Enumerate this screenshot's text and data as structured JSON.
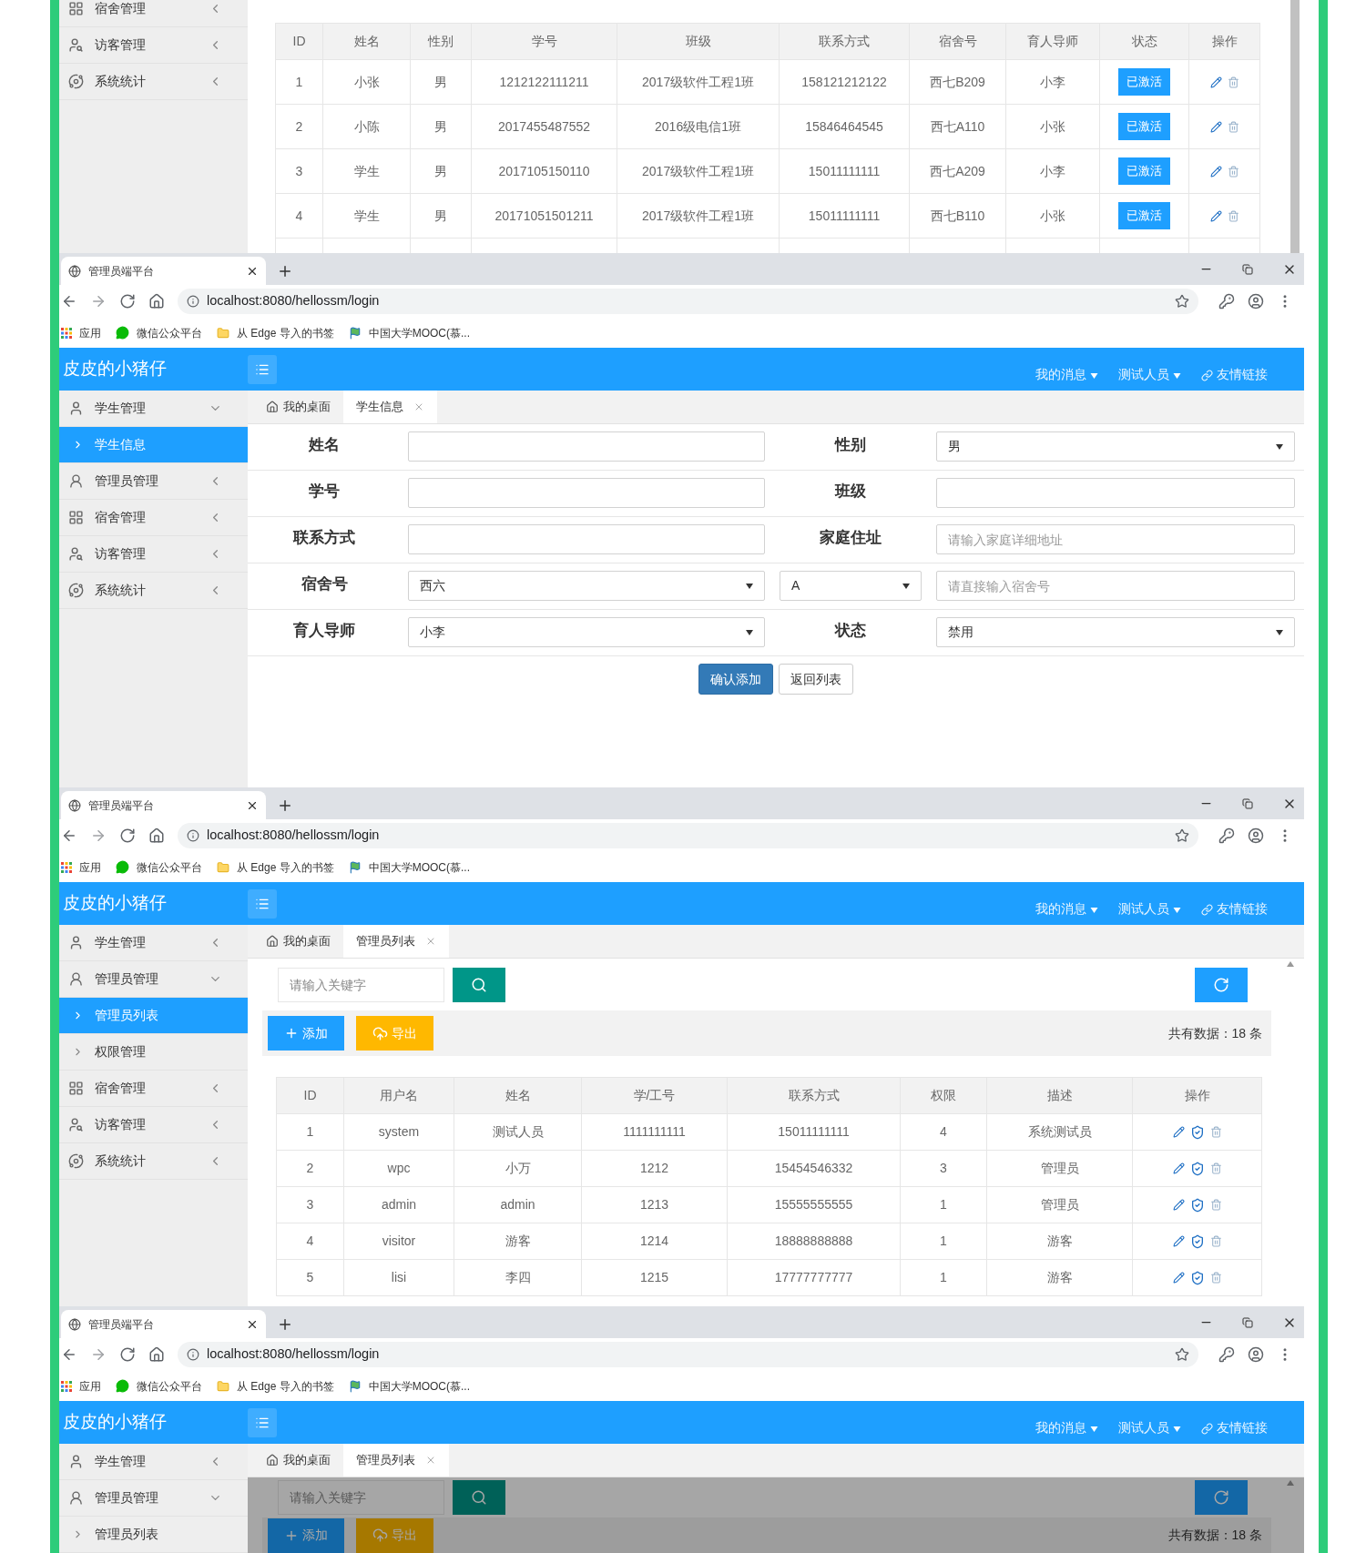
{
  "panels": [
    {
      "kind": "list_fragment",
      "sidebar": [
        {
          "label": "宿舍管理",
          "kind": "dorm",
          "expanded": false,
          "selected": false
        },
        {
          "label": "访客管理",
          "kind": "visitor",
          "expanded": false,
          "selected": false
        },
        {
          "label": "系统统计",
          "kind": "stats",
          "expanded": false,
          "selected": false
        }
      ],
      "table": {
        "columns": [
          "ID",
          "姓名",
          "性别",
          "学号",
          "班级",
          "联系方式",
          "宿舍号",
          "育人导师",
          "状态",
          "操作"
        ],
        "rows": [
          {
            "cells": [
              "1",
              "小张",
              "男",
              "1212122111211",
              "2017级软件工程1班",
              "158121212122",
              "西七B209",
              "小李"
            ],
            "status": "已激活"
          },
          {
            "cells": [
              "2",
              "小陈",
              "男",
              "2017455487552",
              "2016级电信1班",
              "15846464545",
              "西七A110",
              "小张"
            ],
            "status": "已激活"
          },
          {
            "cells": [
              "3",
              "学生",
              "男",
              "2017105150110",
              "2017级软件工程1班",
              "15011111111",
              "西七A209",
              "小李"
            ],
            "status": "已激活"
          },
          {
            "cells": [
              "4",
              "学生",
              "男",
              "20171051501211",
              "2017级软件工程1班",
              "15011111111",
              "西七B110",
              "小张"
            ],
            "status": "已激活"
          }
        ]
      }
    },
    {
      "kind": "browser",
      "tab_title": "管理员端平台",
      "url": "localhost:8080/hellossm/login",
      "bookmarks": [
        {
          "kind": "apps",
          "label": "应用"
        },
        {
          "kind": "wechat",
          "label": "微信公众平台"
        },
        {
          "kind": "folder",
          "label": "从 Edge 导入的书签"
        },
        {
          "kind": "mooc",
          "label": "中国大学MOOC(慕..."
        }
      ],
      "brand": "皮皮的小猪仔",
      "header_menu": [
        {
          "kind": "dropdown",
          "label": "我的消息"
        },
        {
          "kind": "dropdown",
          "label": "测试人员"
        },
        {
          "kind": "link",
          "label": "友情链接"
        }
      ],
      "sidebar": [
        {
          "label": "学生管理",
          "kind": "student",
          "expanded": true,
          "selected": false,
          "children": [
            {
              "label": "学生信息",
              "selected": true
            }
          ]
        },
        {
          "label": "管理员管理",
          "kind": "admin",
          "expanded": false,
          "selected": false
        },
        {
          "label": "宿舍管理",
          "kind": "dorm",
          "expanded": false,
          "selected": false
        },
        {
          "label": "访客管理",
          "kind": "visitor",
          "expanded": false,
          "selected": false
        },
        {
          "label": "系统统计",
          "kind": "stats",
          "expanded": false,
          "selected": false
        }
      ],
      "page_tabs": [
        {
          "kind": "home",
          "label": "我的桌面",
          "selected": false
        },
        {
          "kind": "page",
          "label": "学生信息",
          "selected": true
        }
      ],
      "content": {
        "kind": "form",
        "rows": [
          [
            {
              "kind": "label",
              "text": "姓名"
            },
            {
              "kind": "input"
            },
            {
              "kind": "label",
              "text": "性别"
            },
            {
              "kind": "select",
              "value": "男"
            }
          ],
          [
            {
              "kind": "label",
              "text": "学号"
            },
            {
              "kind": "input"
            },
            {
              "kind": "label",
              "text": "班级"
            },
            {
              "kind": "input"
            }
          ],
          [
            {
              "kind": "label",
              "text": "联系方式"
            },
            {
              "kind": "input"
            },
            {
              "kind": "label",
              "text": "家庭住址"
            },
            {
              "kind": "input",
              "placeholder": "请输入家庭详细地址"
            }
          ],
          [
            {
              "kind": "label",
              "text": "宿舍号"
            },
            {
              "kind": "select",
              "value": "西六"
            },
            {
              "kind": "select",
              "value": "A"
            },
            {
              "kind": "input",
              "placeholder": "请直接输入宿舍号"
            }
          ],
          [
            {
              "kind": "label",
              "text": "育人导师"
            },
            {
              "kind": "select",
              "value": "小李"
            },
            {
              "kind": "label",
              "text": "状态"
            },
            {
              "kind": "select",
              "value": "禁用"
            }
          ]
        ],
        "buttons": [
          {
            "kind": "primary",
            "label": "确认添加"
          },
          {
            "kind": "default",
            "label": "返回列表"
          }
        ]
      }
    },
    {
      "kind": "browser",
      "tab_title": "管理员端平台",
      "url": "localhost:8080/hellossm/login",
      "bookmarks": [
        {
          "kind": "apps",
          "label": "应用"
        },
        {
          "kind": "wechat",
          "label": "微信公众平台"
        },
        {
          "kind": "folder",
          "label": "从 Edge 导入的书签"
        },
        {
          "kind": "mooc",
          "label": "中国大学MOOC(慕..."
        }
      ],
      "brand": "皮皮的小猪仔",
      "header_menu": [
        {
          "kind": "dropdown",
          "label": "我的消息"
        },
        {
          "kind": "dropdown",
          "label": "测试人员"
        },
        {
          "kind": "link",
          "label": "友情链接"
        }
      ],
      "sidebar": [
        {
          "label": "学生管理",
          "kind": "student",
          "expanded": false,
          "selected": false
        },
        {
          "label": "管理员管理",
          "kind": "admin",
          "expanded": true,
          "selected": false,
          "children": [
            {
              "label": "管理员列表",
              "selected": true
            },
            {
              "label": "权限管理",
              "selected": false
            }
          ]
        },
        {
          "label": "宿舍管理",
          "kind": "dorm",
          "expanded": false,
          "selected": false
        },
        {
          "label": "访客管理",
          "kind": "visitor",
          "expanded": false,
          "selected": false
        },
        {
          "label": "系统统计",
          "kind": "stats",
          "expanded": false,
          "selected": false
        }
      ],
      "page_tabs": [
        {
          "kind": "home",
          "label": "我的桌面",
          "selected": false
        },
        {
          "kind": "page",
          "label": "管理员列表",
          "selected": true
        }
      ],
      "content": {
        "kind": "list",
        "dimmed": false,
        "search": {
          "placeholder": "请输入关键字"
        },
        "buttons": [
          {
            "kind": "add",
            "label": "添加"
          },
          {
            "kind": "export",
            "label": "导出"
          }
        ],
        "total": "共有数据：18 条",
        "table": {
          "columns": [
            "ID",
            "用户名",
            "姓名",
            "学/工号",
            "联系方式",
            "权限",
            "描述",
            "操作"
          ],
          "rows": [
            {
              "cells": [
                "1",
                "system",
                "测试人员",
                "1111111111",
                "15011111111",
                "4",
                "系统测试员"
              ]
            },
            {
              "cells": [
                "2",
                "wpc",
                "小万",
                "1212",
                "15454546332",
                "3",
                "管理员"
              ]
            },
            {
              "cells": [
                "3",
                "admin",
                "admin",
                "1213",
                "15555555555",
                "1",
                "管理员"
              ]
            },
            {
              "cells": [
                "4",
                "visitor",
                "游客",
                "1214",
                "18888888888",
                "1",
                "游客"
              ]
            },
            {
              "cells": [
                "5",
                "lisi",
                "李四",
                "1215",
                "17777777777",
                "1",
                "游客"
              ]
            }
          ]
        }
      }
    },
    {
      "kind": "browser",
      "tab_title": "管理员端平台",
      "url": "localhost:8080/hellossm/login",
      "bookmarks": [
        {
          "kind": "apps",
          "label": "应用"
        },
        {
          "kind": "wechat",
          "label": "微信公众平台"
        },
        {
          "kind": "folder",
          "label": "从 Edge 导入的书签"
        },
        {
          "kind": "mooc",
          "label": "中国大学MOOC(慕..."
        }
      ],
      "brand": "皮皮的小猪仔",
      "header_menu": [
        {
          "kind": "dropdown",
          "label": "我的消息"
        },
        {
          "kind": "dropdown",
          "label": "测试人员"
        },
        {
          "kind": "link",
          "label": "友情链接"
        }
      ],
      "sidebar": [
        {
          "label": "学生管理",
          "kind": "student",
          "expanded": false,
          "selected": false
        },
        {
          "label": "管理员管理",
          "kind": "admin",
          "expanded": true,
          "selected": false,
          "children": [
            {
              "label": "管理员列表",
              "selected": false
            }
          ]
        }
      ],
      "page_tabs": [
        {
          "kind": "home",
          "label": "我的桌面",
          "selected": false
        },
        {
          "kind": "page",
          "label": "管理员列表",
          "selected": true
        }
      ],
      "content": {
        "kind": "list",
        "dimmed": true,
        "search": {
          "placeholder": "请输入关键字"
        },
        "buttons": [
          {
            "kind": "add",
            "label": "添加"
          },
          {
            "kind": "export",
            "label": "导出"
          }
        ],
        "total": "共有数据：18 条"
      }
    }
  ]
}
